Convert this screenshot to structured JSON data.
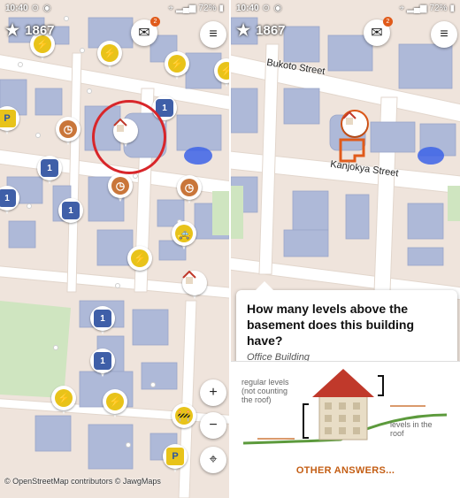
{
  "status_bar": {
    "left_time": "10:40",
    "right_time": "10:40",
    "battery": "72%"
  },
  "header": {
    "star_icon": "star-icon",
    "score": "1867",
    "messages_badge": "2"
  },
  "map": {
    "attribution": "© OpenStreetMap contributors © JawgMaps",
    "streets": {
      "bukoto": "Bukoto Street",
      "kanjokya": "Kanjokya Street"
    }
  },
  "controls": {
    "zoom_in": "+",
    "zoom_out": "−"
  },
  "quest": {
    "title": "How many levels above the basement does this building have?",
    "subtitle": "Office Building",
    "diagram_labels": {
      "regular_levels": "regular levels\n(not counting\nthe roof)",
      "roof_levels": "levels in the\nroof"
    },
    "other_answers": "OTHER ANSWERS..."
  },
  "colors": {
    "accent": "#c45e14",
    "highlight": "#d8262a",
    "building": "#aeb9d8",
    "road": "#ffffff",
    "ground": "#efe4dc"
  }
}
